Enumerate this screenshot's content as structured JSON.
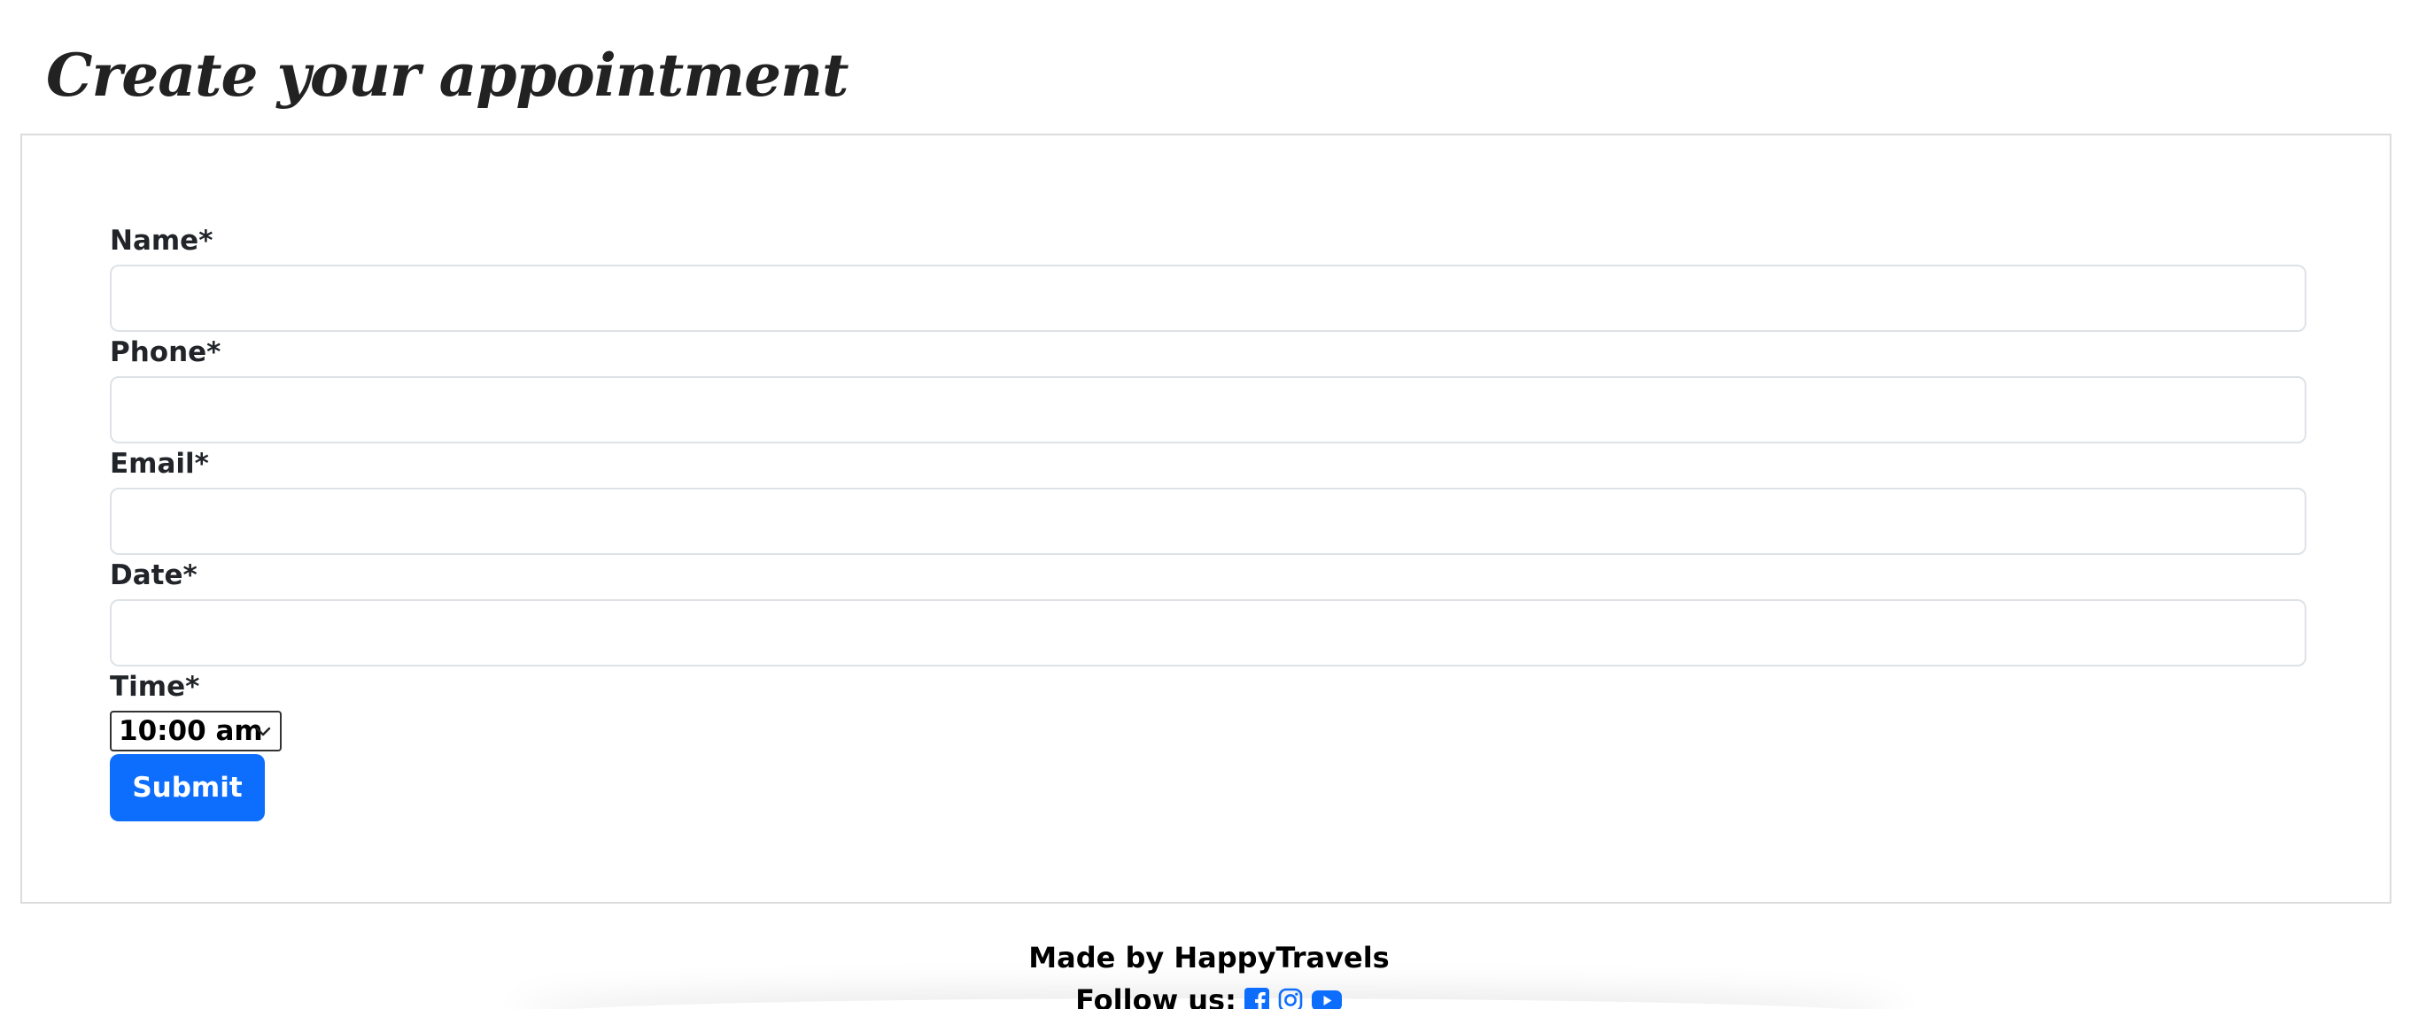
{
  "page": {
    "title": "Create your appointment"
  },
  "form": {
    "fields": [
      {
        "label": "Name*",
        "value": "",
        "placeholder": ""
      },
      {
        "label": "Phone*",
        "value": "",
        "placeholder": ""
      },
      {
        "label": "Email*",
        "value": "",
        "placeholder": ""
      },
      {
        "label": "Date*",
        "value": "",
        "placeholder": ""
      }
    ],
    "time": {
      "label": "Time*",
      "selected": "10:00 am"
    },
    "submit_label": "Submit"
  },
  "footer": {
    "made_by": "Made by HappyTravels",
    "follow_label": "Follow us:",
    "social_icons": [
      "facebook-icon",
      "instagram-icon",
      "youtube-icon"
    ]
  },
  "colors": {
    "accent": "#0d6efd",
    "text": "#212529",
    "card_border": "#dcdcdc",
    "input_border": "#dee2e6"
  }
}
